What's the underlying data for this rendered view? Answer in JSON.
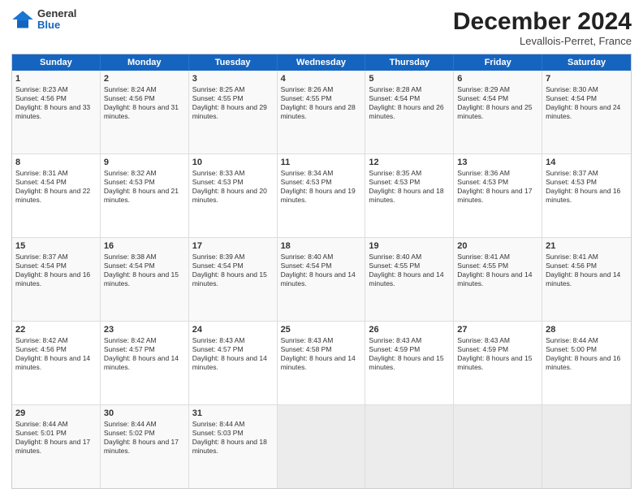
{
  "header": {
    "logo_general": "General",
    "logo_blue": "Blue",
    "month_title": "December 2024",
    "location": "Levallois-Perret, France"
  },
  "weekdays": [
    "Sunday",
    "Monday",
    "Tuesday",
    "Wednesday",
    "Thursday",
    "Friday",
    "Saturday"
  ],
  "weeks": [
    [
      {
        "day": "1",
        "sunrise": "8:23 AM",
        "sunset": "4:56 PM",
        "daylight": "8 hours and 33 minutes."
      },
      {
        "day": "2",
        "sunrise": "8:24 AM",
        "sunset": "4:56 PM",
        "daylight": "8 hours and 31 minutes."
      },
      {
        "day": "3",
        "sunrise": "8:25 AM",
        "sunset": "4:55 PM",
        "daylight": "8 hours and 29 minutes."
      },
      {
        "day": "4",
        "sunrise": "8:26 AM",
        "sunset": "4:55 PM",
        "daylight": "8 hours and 28 minutes."
      },
      {
        "day": "5",
        "sunrise": "8:28 AM",
        "sunset": "4:54 PM",
        "daylight": "8 hours and 26 minutes."
      },
      {
        "day": "6",
        "sunrise": "8:29 AM",
        "sunset": "4:54 PM",
        "daylight": "8 hours and 25 minutes."
      },
      {
        "day": "7",
        "sunrise": "8:30 AM",
        "sunset": "4:54 PM",
        "daylight": "8 hours and 24 minutes."
      }
    ],
    [
      {
        "day": "8",
        "sunrise": "8:31 AM",
        "sunset": "4:54 PM",
        "daylight": "8 hours and 22 minutes."
      },
      {
        "day": "9",
        "sunrise": "8:32 AM",
        "sunset": "4:53 PM",
        "daylight": "8 hours and 21 minutes."
      },
      {
        "day": "10",
        "sunrise": "8:33 AM",
        "sunset": "4:53 PM",
        "daylight": "8 hours and 20 minutes."
      },
      {
        "day": "11",
        "sunrise": "8:34 AM",
        "sunset": "4:53 PM",
        "daylight": "8 hours and 19 minutes."
      },
      {
        "day": "12",
        "sunrise": "8:35 AM",
        "sunset": "4:53 PM",
        "daylight": "8 hours and 18 minutes."
      },
      {
        "day": "13",
        "sunrise": "8:36 AM",
        "sunset": "4:53 PM",
        "daylight": "8 hours and 17 minutes."
      },
      {
        "day": "14",
        "sunrise": "8:37 AM",
        "sunset": "4:53 PM",
        "daylight": "8 hours and 16 minutes."
      }
    ],
    [
      {
        "day": "15",
        "sunrise": "8:37 AM",
        "sunset": "4:54 PM",
        "daylight": "8 hours and 16 minutes."
      },
      {
        "day": "16",
        "sunrise": "8:38 AM",
        "sunset": "4:54 PM",
        "daylight": "8 hours and 15 minutes."
      },
      {
        "day": "17",
        "sunrise": "8:39 AM",
        "sunset": "4:54 PM",
        "daylight": "8 hours and 15 minutes."
      },
      {
        "day": "18",
        "sunrise": "8:40 AM",
        "sunset": "4:54 PM",
        "daylight": "8 hours and 14 minutes."
      },
      {
        "day": "19",
        "sunrise": "8:40 AM",
        "sunset": "4:55 PM",
        "daylight": "8 hours and 14 minutes."
      },
      {
        "day": "20",
        "sunrise": "8:41 AM",
        "sunset": "4:55 PM",
        "daylight": "8 hours and 14 minutes."
      },
      {
        "day": "21",
        "sunrise": "8:41 AM",
        "sunset": "4:56 PM",
        "daylight": "8 hours and 14 minutes."
      }
    ],
    [
      {
        "day": "22",
        "sunrise": "8:42 AM",
        "sunset": "4:56 PM",
        "daylight": "8 hours and 14 minutes."
      },
      {
        "day": "23",
        "sunrise": "8:42 AM",
        "sunset": "4:57 PM",
        "daylight": "8 hours and 14 minutes."
      },
      {
        "day": "24",
        "sunrise": "8:43 AM",
        "sunset": "4:57 PM",
        "daylight": "8 hours and 14 minutes."
      },
      {
        "day": "25",
        "sunrise": "8:43 AM",
        "sunset": "4:58 PM",
        "daylight": "8 hours and 14 minutes."
      },
      {
        "day": "26",
        "sunrise": "8:43 AM",
        "sunset": "4:59 PM",
        "daylight": "8 hours and 15 minutes."
      },
      {
        "day": "27",
        "sunrise": "8:43 AM",
        "sunset": "4:59 PM",
        "daylight": "8 hours and 15 minutes."
      },
      {
        "day": "28",
        "sunrise": "8:44 AM",
        "sunset": "5:00 PM",
        "daylight": "8 hours and 16 minutes."
      }
    ],
    [
      {
        "day": "29",
        "sunrise": "8:44 AM",
        "sunset": "5:01 PM",
        "daylight": "8 hours and 17 minutes."
      },
      {
        "day": "30",
        "sunrise": "8:44 AM",
        "sunset": "5:02 PM",
        "daylight": "8 hours and 17 minutes."
      },
      {
        "day": "31",
        "sunrise": "8:44 AM",
        "sunset": "5:03 PM",
        "daylight": "8 hours and 18 minutes."
      },
      null,
      null,
      null,
      null
    ]
  ]
}
